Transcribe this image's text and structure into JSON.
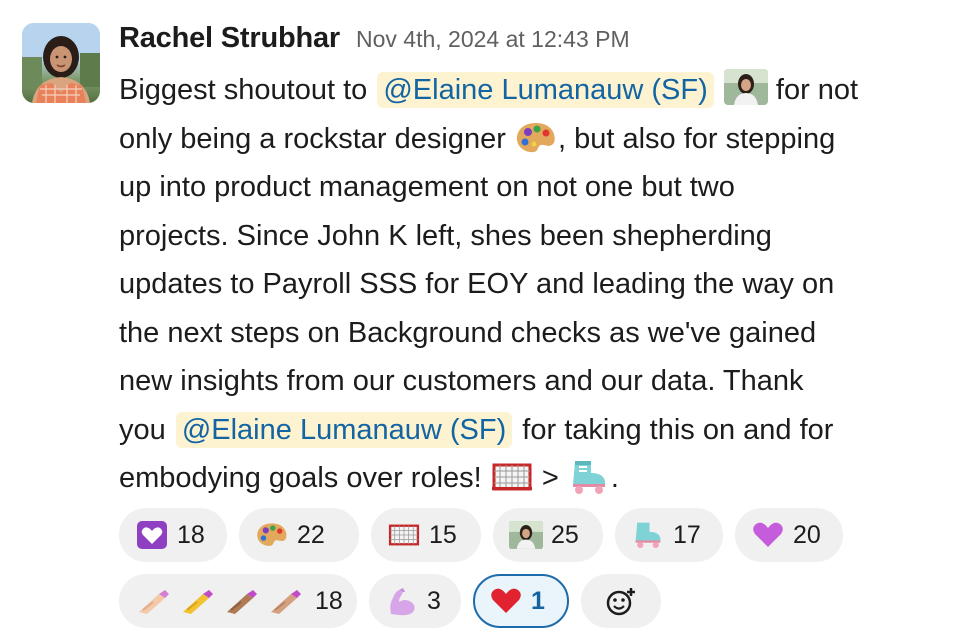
{
  "message": {
    "author": "Rachel Strubhar",
    "timestamp": "Nov 4th, 2024 at 12:43 PM",
    "mention_name": "@Elaine Lumanauw (SF)",
    "lines": [
      {
        "before": "Biggest shoutout to ",
        "after": " for not"
      },
      {
        "before": "only being a rockstar designer ",
        "after": ", but also for stepping"
      },
      {
        "text": "up into product management on not one but two"
      },
      {
        "text": "projects.  Since John K left, shes been shepherding"
      },
      {
        "text": "updates to Payroll SSS for EOY and leading the way on"
      },
      {
        "text": "the next steps on Background checks as we've gained"
      },
      {
        "text": "new insights from our customers and our data.  Thank"
      },
      {
        "before": "you ",
        "after": " for taking this on and for"
      },
      {
        "before": "embodying goals over roles! ",
        "mid": " > ",
        "after": "."
      }
    ],
    "inline_emojis": [
      "profile-photo-emoji",
      "artist-palette-emoji",
      "goal-net-emoji",
      "roller-skate-emoji"
    ]
  },
  "reactions": {
    "row1": [
      {
        "icon": "heart-decoration-icon",
        "count": "18"
      },
      {
        "icon": "artist-palette-icon",
        "count": "22"
      },
      {
        "icon": "goal-net-icon",
        "count": "15"
      },
      {
        "icon": "profile-photo-icon",
        "count": "25"
      },
      {
        "icon": "roller-skate-icon",
        "count": "17"
      },
      {
        "icon": "purple-heart-icon",
        "count": "20"
      }
    ],
    "row2": [
      {
        "icon": "nail-polish-icons",
        "count": "18"
      },
      {
        "icon": "flexed-biceps-icon",
        "count": "3"
      },
      {
        "icon": "red-heart-icon",
        "count": "1",
        "selected": true
      },
      {
        "icon": "add-reaction-icon"
      }
    ]
  },
  "colors": {
    "mention_bg": "#fdf3d1",
    "mention_text": "#1264a3",
    "selected_border": "#1d6ba8",
    "reaction_bg": "#f0f0f0"
  }
}
